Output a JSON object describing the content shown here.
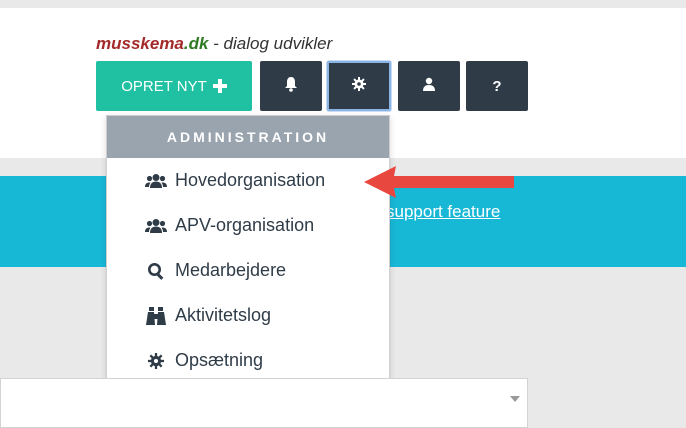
{
  "header": {
    "brand_part1": "musskema",
    "brand_part2": ".dk",
    "brand_tagline": " - dialog udvikler"
  },
  "toolbar": {
    "create_label": "OPRET NYT",
    "help_label": "?",
    "icons": [
      "plus-icon",
      "bell-icon",
      "gear-icon",
      "user-icon"
    ]
  },
  "banner": {
    "link_text": "support feature",
    "color": "#17b8d6"
  },
  "menu": {
    "header": "ADMINISTRATION",
    "items": [
      {
        "label": "Hovedorganisation",
        "icon": "users-icon"
      },
      {
        "label": "APV-organisation",
        "icon": "users-icon"
      },
      {
        "label": "Medarbejdere",
        "icon": "search-icon"
      },
      {
        "label": "Aktivitetslog",
        "icon": "binoculars-icon"
      },
      {
        "label": "Opsætning",
        "icon": "gear-icon"
      }
    ]
  },
  "colors": {
    "accent": "#20c0a2",
    "dark_button": "#2f3c48",
    "arrow": "#e8473f"
  }
}
